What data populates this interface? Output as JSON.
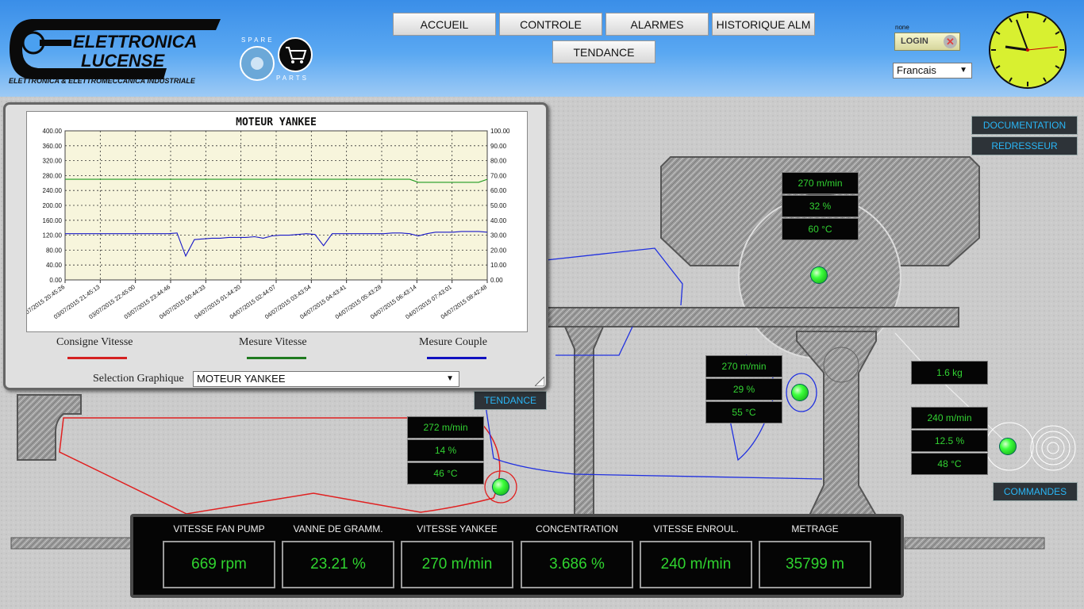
{
  "brand": {
    "name_line1": "ELETTRONICA",
    "name_line2": "LUCENSE",
    "subtitle": "ELETTRONICA & ELETTROMECCANICA INDUSTRIALE",
    "spare_top": "SPARE",
    "spare_bottom": "PARTS"
  },
  "nav": {
    "items": [
      "ACCUEIL",
      "CONTROLE",
      "ALARMES",
      "HISTORIQUE ALM",
      "TENDANCE"
    ]
  },
  "login": {
    "user": "none",
    "label": "LOGIN"
  },
  "language": {
    "selected": "Francais"
  },
  "side_buttons": {
    "documentation": "DOCUMENTATION",
    "redresseur": "REDRESSEUR",
    "tendance": "TENDANCE",
    "commandes": "COMMANDES"
  },
  "readouts": {
    "yankee": [
      "270 m/min",
      "32 %",
      "60 °C"
    ],
    "press": [
      "270 m/min",
      "29 %",
      "55 °C"
    ],
    "left": [
      "272 m/min",
      "14 %",
      "46 °C"
    ],
    "tension": "1.6 kg",
    "winder": [
      "240 m/min",
      "12.5 %",
      "48 °C"
    ]
  },
  "chart_window": {
    "legend": [
      "Consigne Vitesse",
      "Mesure Vitesse",
      "Mesure Couple"
    ],
    "legend_colors": [
      "#d42020",
      "#1f7a1f",
      "#1010c0"
    ],
    "selection_label": "Selection Graphique",
    "selection_value": "MOTEUR YANKEE"
  },
  "chart_data": {
    "type": "line",
    "title": "MOTEUR YANKEE",
    "y_left_ticks": [
      "400.00",
      "360.00",
      "320.00",
      "280.00",
      "240.00",
      "200.00",
      "160.00",
      "120.00",
      "80.00",
      "40.00",
      "0.00"
    ],
    "y_right_ticks": [
      "100.00",
      "90.00",
      "80.00",
      "70.00",
      "60.00",
      "50.00",
      "40.00",
      "30.00",
      "20.00",
      "10.00",
      "0.00"
    ],
    "ylim_left": [
      0,
      400
    ],
    "ylim_right": [
      0,
      100
    ],
    "x_labels": [
      "03/07/2015 20:45:26",
      "03/07/2015 21:45:13",
      "03/07/2015 22:45:00",
      "03/07/2015 23:44:46",
      "04/07/2015 00:44:33",
      "04/07/2015 01:44:20",
      "04/07/2015 02:44:07",
      "04/07/2015 03:43:54",
      "04/07/2015 04:43:41",
      "04/07/2015 05:43:28",
      "04/07/2015 06:43:14",
      "04/07/2015 07:43:01",
      "04/07/2015 08:42:48"
    ],
    "grid": true,
    "series": [
      {
        "name": "Mesure Vitesse",
        "axis": "left",
        "color": "#1f9a1f",
        "values": [
          270,
          270,
          270,
          270,
          270,
          270,
          270,
          270,
          270,
          270,
          270,
          270,
          270,
          270,
          270,
          270,
          270,
          270,
          270,
          270,
          270,
          270,
          270,
          270,
          270,
          270,
          270,
          270,
          270,
          270,
          270,
          270,
          270,
          270,
          270,
          270,
          270,
          270,
          270,
          270,
          270,
          262,
          262,
          262,
          262,
          262,
          262,
          262,
          262,
          270
        ]
      },
      {
        "name": "Mesure Couple",
        "axis": "right",
        "color": "#1818c8",
        "values": [
          31,
          31,
          31,
          31,
          31,
          31,
          31,
          31,
          31,
          31,
          31,
          31,
          31,
          31.5,
          16,
          27,
          27.5,
          28,
          28,
          28.5,
          28.5,
          28.5,
          29,
          28,
          29.5,
          30,
          30,
          30.5,
          31,
          30.5,
          23,
          31,
          31,
          31,
          31,
          31,
          31,
          31,
          31.5,
          31.5,
          31,
          29.5,
          31,
          32,
          32,
          32,
          32.5,
          32.5,
          32.5,
          32
        ]
      }
    ]
  },
  "metrics": [
    {
      "label": "VITESSE FAN PUMP",
      "value": "669 rpm"
    },
    {
      "label": "VANNE DE GRAMM.",
      "value": "23.21 %"
    },
    {
      "label": "VITESSE YANKEE",
      "value": "270 m/min"
    },
    {
      "label": "CONCENTRATION",
      "value": "3.686 %"
    },
    {
      "label": "VITESSE ENROUL.",
      "value": "240 m/min"
    },
    {
      "label": "METRAGE",
      "value": "35799 m"
    }
  ]
}
